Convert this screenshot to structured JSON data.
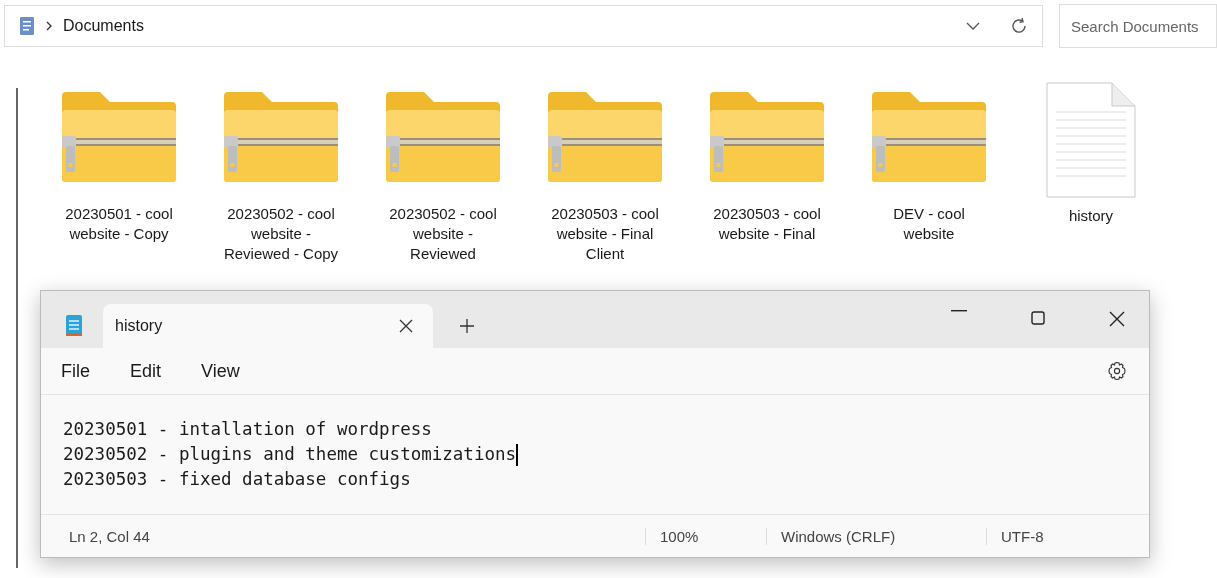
{
  "address_bar": {
    "path": [
      {
        "label": "Documents"
      }
    ],
    "search": {
      "placeholder": "Search Documents"
    }
  },
  "items": [
    {
      "kind": "zip",
      "label": "20230501 - cool website - Copy"
    },
    {
      "kind": "zip",
      "label": "20230502 - cool website - Reviewed - Copy"
    },
    {
      "kind": "zip",
      "label": "20230502 - cool website - Reviewed"
    },
    {
      "kind": "zip",
      "label": "20230503 - cool website - Final Client"
    },
    {
      "kind": "zip",
      "label": "20230503 - cool website - Final"
    },
    {
      "kind": "zip",
      "label": "DEV - cool website"
    },
    {
      "kind": "text",
      "label": "history"
    }
  ],
  "notepad": {
    "tabs": [
      {
        "label": "history",
        "selected": true
      }
    ],
    "menu": [
      "File",
      "Edit",
      "View"
    ],
    "lines": [
      {
        "text": "20230501 - intallation of wordpress",
        "cursor": false
      },
      {
        "text": "20230502 - plugins and theme customizations",
        "cursor": true
      },
      {
        "text": "20230503 - fixed database configs",
        "cursor": false
      }
    ],
    "status_bar": {
      "position": "Ln 2, Col 44",
      "zoom": "100%",
      "line_ending": "Windows (CRLF)",
      "encoding": "UTF-8"
    }
  }
}
